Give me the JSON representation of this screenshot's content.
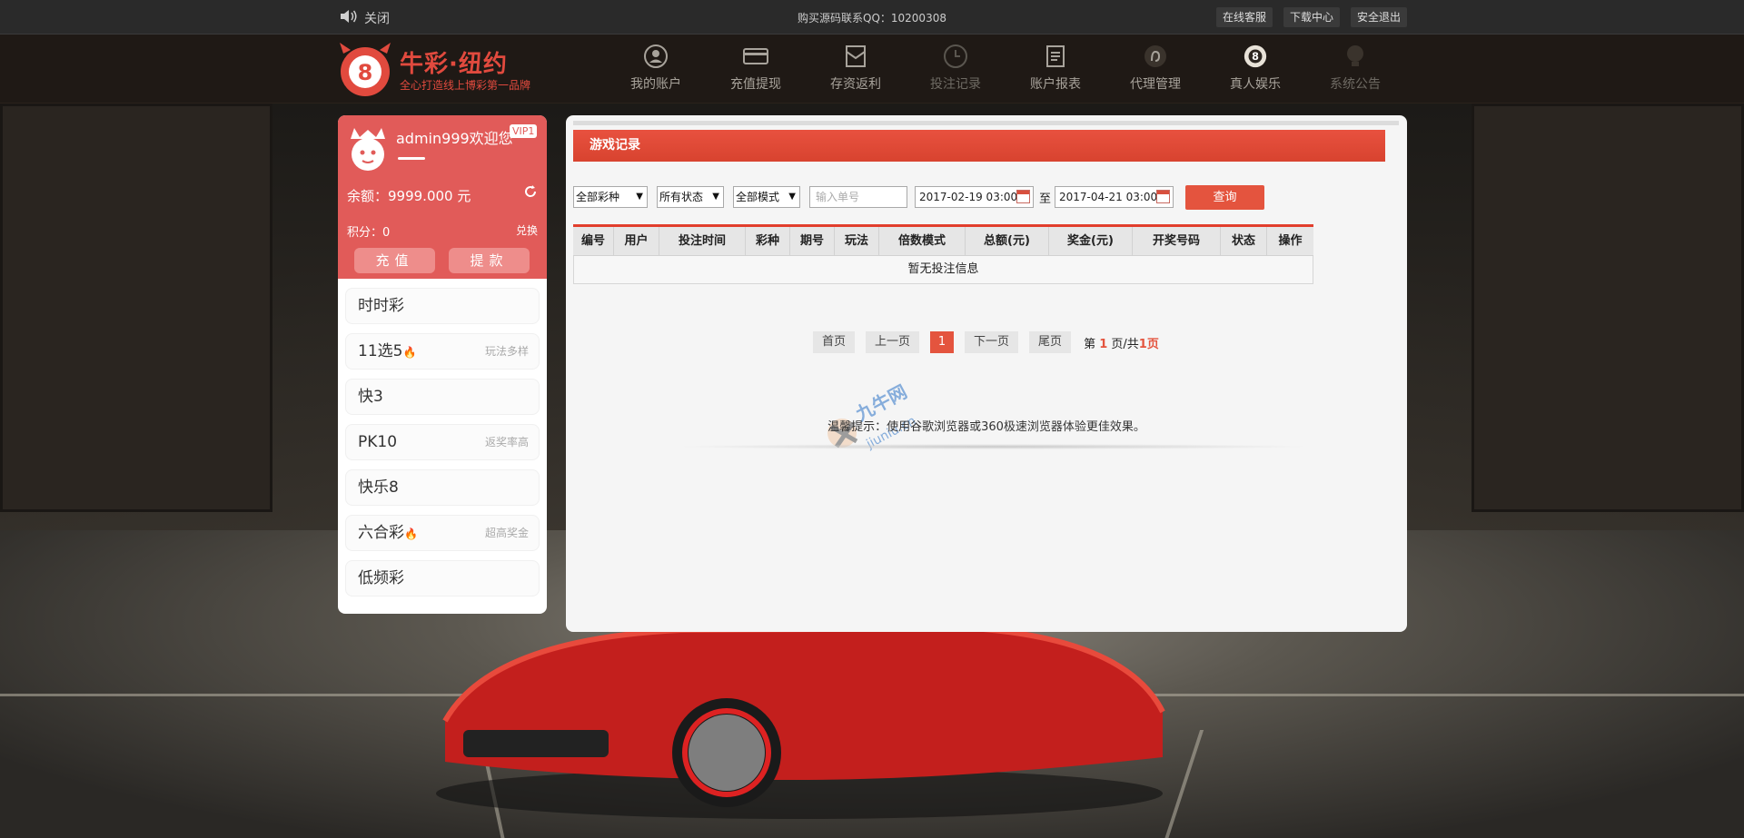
{
  "topbar": {
    "sound_label": "关闭",
    "qq_text": "购买源码联系QQ：10200308",
    "links": [
      "在线客服",
      "下载中心",
      "安全退出"
    ]
  },
  "logo": {
    "title": "牛彩·纽约",
    "slogan": "全心打造线上博彩第一品牌",
    "badge_text": "8"
  },
  "nav": [
    {
      "label": "我的账户",
      "icon": "user-icon"
    },
    {
      "label": "充值提现",
      "icon": "card-icon"
    },
    {
      "label": "存资返利",
      "icon": "envelope-icon"
    },
    {
      "label": "投注记录",
      "icon": "clock-icon"
    },
    {
      "label": "账户报表",
      "icon": "report-icon"
    },
    {
      "label": "代理管理",
      "icon": "agent-icon"
    },
    {
      "label": "真人娱乐",
      "icon": "ball8-icon"
    },
    {
      "label": "系统公告",
      "icon": "bulb-icon"
    }
  ],
  "user": {
    "name": "admin999欢迎您",
    "vip": "VIP1",
    "balance": "余额：9999.000 元",
    "points": "积分：0",
    "exchange": "兑换",
    "recharge": "充值",
    "withdraw": "提款"
  },
  "games": [
    {
      "name": "时时彩",
      "tag": "",
      "hot": false
    },
    {
      "name": "11选5",
      "tag": "玩法多样",
      "hot": true
    },
    {
      "name": "快3",
      "tag": "",
      "hot": false
    },
    {
      "name": "PK10",
      "tag": "返奖率高",
      "hot": false
    },
    {
      "name": "快乐8",
      "tag": "",
      "hot": false
    },
    {
      "name": "六合彩",
      "tag": "超高奖金",
      "hot": true
    },
    {
      "name": "低频彩",
      "tag": "",
      "hot": false
    }
  ],
  "main": {
    "title": "游戏记录",
    "filters": {
      "lottery": "全部彩种",
      "status": "所有状态",
      "mode": "全部模式",
      "order_placeholder": "输入单号",
      "date_from": "2017-02-19 03:00",
      "to": "至",
      "date_to": "2017-04-21 03:00",
      "query": "查询"
    },
    "table": {
      "headers": [
        "编号",
        "用户",
        "投注时间",
        "彩种",
        "期号",
        "玩法",
        "倍数模式",
        "总额(元)",
        "奖金(元)",
        "开奖号码",
        "状态",
        "操作"
      ],
      "empty": "暂无投注信息"
    },
    "pager": {
      "first": "首页",
      "prev": "上一页",
      "current": "1",
      "next": "下一页",
      "last": "尾页",
      "info_prefix": "第",
      "info_page": "1",
      "info_mid": "页/共",
      "info_total": "1页"
    },
    "tip": "温馨提示：使用谷歌浏览器或360极速浏览器体验更佳效果。"
  },
  "colors": {
    "accent": "#e4543e",
    "panel_red": "#e15b59",
    "header_bg": "#1f1915"
  }
}
